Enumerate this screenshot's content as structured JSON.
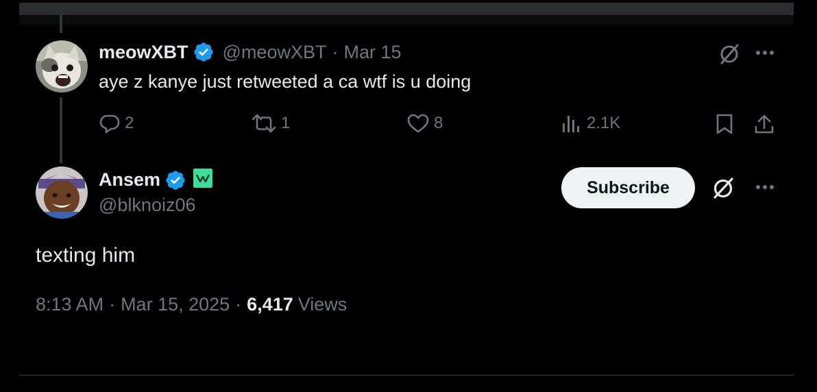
{
  "reply": {
    "display_name": "meowXBT",
    "handle": "@meowXBT",
    "separator": "·",
    "date": "Mar 15",
    "text": "aye z kanye just retweeted a ca wtf is u doing",
    "actions": {
      "replies": "2",
      "reposts": "1",
      "likes": "8",
      "views": "2.1K"
    },
    "icons": [
      "grok-icon",
      "more-icon",
      "reply-icon",
      "repost-icon",
      "like-icon",
      "views-icon",
      "bookmark-icon",
      "share-icon"
    ]
  },
  "main": {
    "display_name": "Ansem",
    "handle": "@blknoiz06",
    "subscribe_label": "Subscribe",
    "text": "texting him",
    "time": "8:13 AM",
    "date": "Mar 15, 2025",
    "dot": "·",
    "views_count": "6,417",
    "views_label": "Views"
  },
  "colors": {
    "background": "#000000",
    "text": "#e7e9ea",
    "muted": "#71767b",
    "verified": "#1d9bf0",
    "affiliate_badge": "#3ddc97",
    "subscribe_bg": "#eff3f4"
  }
}
